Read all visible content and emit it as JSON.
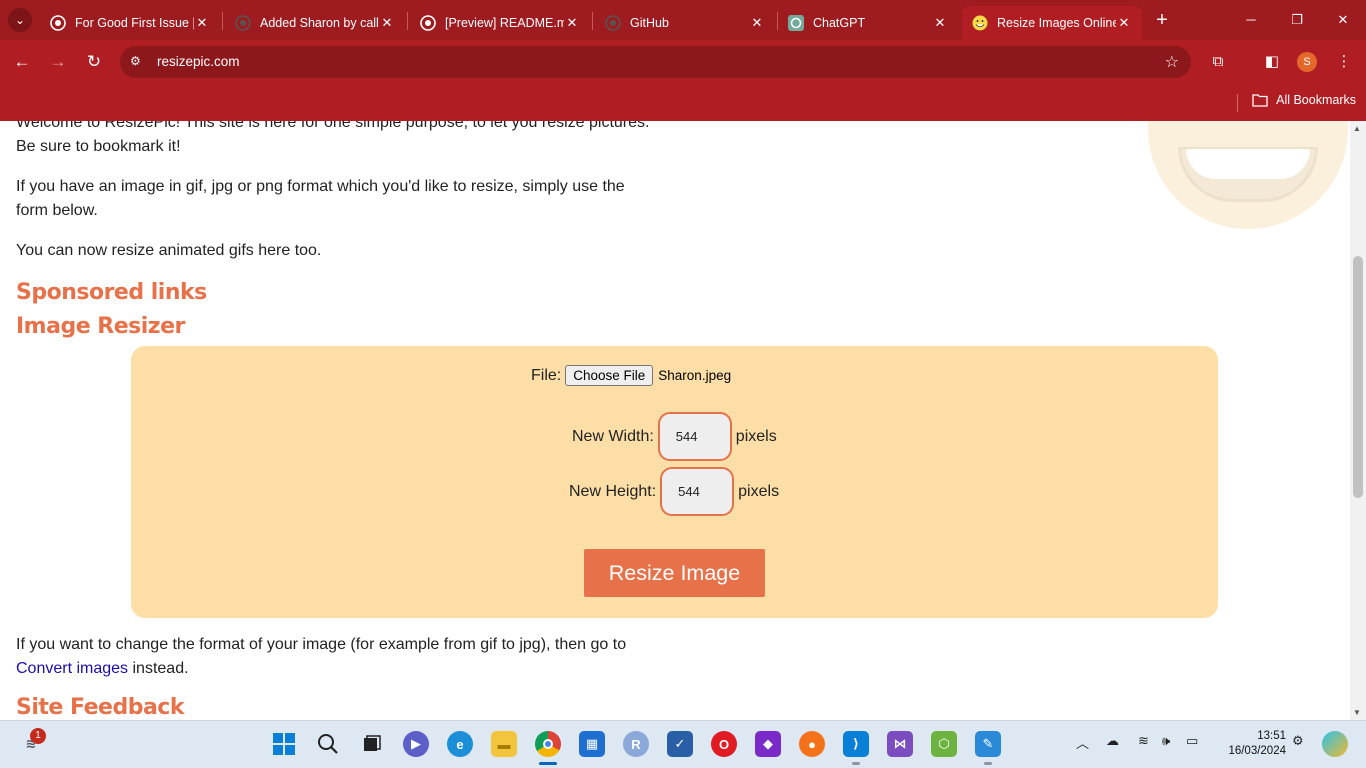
{
  "browser": {
    "tabs": [
      {
        "title": "For Good First Issue |",
        "icon": "github-icon"
      },
      {
        "title": "Added Sharon by call",
        "icon": "github-icon"
      },
      {
        "title": "[Preview] README.m",
        "icon": "github-icon"
      },
      {
        "title": "GitHub",
        "icon": "github-icon"
      },
      {
        "title": "ChatGPT",
        "icon": "chatgpt-icon"
      },
      {
        "title": "Resize Images Online",
        "icon": "smiley-favicon",
        "active": true
      }
    ],
    "url": "resizepic.com",
    "bookmarks_label": "All Bookmarks",
    "profile_initial": "S",
    "accent_color": "#b01e23"
  },
  "page": {
    "intro_line1": "Welcome to ResizePic! This site is here for one simple purpose, to let you resize pictures.",
    "intro_line2": "Be sure to bookmark it!",
    "format_text": "If you have an image in gif, jpg or png format which you'd like to resize, simply use the form below.",
    "animated_text": "You can now resize animated gifs here too.",
    "sponsored_heading": "Sponsored links",
    "resizer_heading": "Image Resizer",
    "form": {
      "file_label": "File:",
      "choose_button": "Choose File",
      "file_name": "Sharon.jpeg",
      "width_label": "New Width:",
      "width_value": "544",
      "height_label": "New Height:",
      "height_value": "544",
      "unit": "pixels",
      "submit_label": "Resize Image"
    },
    "convert_text_before": "If you want to change the format of your image (for example from gif to jpg), then go to",
    "convert_link": "Convert images",
    "convert_text_after": "instead.",
    "feedback_heading": "Site Feedback",
    "heading_color": "#e7724a",
    "form_bg_color": "#fddea6"
  },
  "taskbar": {
    "notification_count": "1",
    "clock_time": "13:51",
    "clock_date": "16/03/2024"
  }
}
